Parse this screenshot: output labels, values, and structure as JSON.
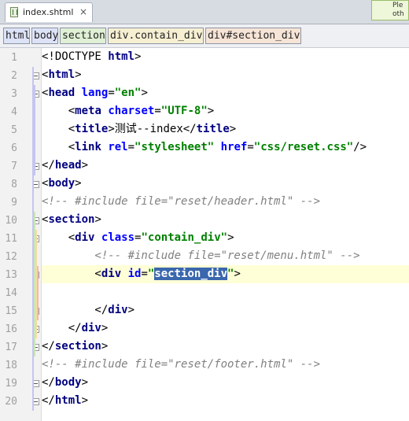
{
  "tab": {
    "filename": "index.shtml",
    "close": "×"
  },
  "hint": {
    "line1": "Ple",
    "line2": "oth"
  },
  "breadcrumb": [
    "html",
    "body",
    "section",
    "div.contain_div",
    "div#section_div"
  ],
  "line_numbers": [
    "1",
    "2",
    "3",
    "4",
    "5",
    "6",
    "7",
    "8",
    "9",
    "10",
    "11",
    "12",
    "13",
    "14",
    "15",
    "16",
    "17",
    "18",
    "19",
    "20"
  ],
  "current_line": "13",
  "code_lines": [
    [
      [
        "p",
        "<!DOCTYPE "
      ],
      [
        "t",
        "html"
      ],
      [
        "p",
        ">"
      ]
    ],
    [
      [
        "p",
        "<"
      ],
      [
        "t",
        "html"
      ],
      [
        "p",
        ">"
      ]
    ],
    [
      [
        "p",
        "<"
      ],
      [
        "t",
        "head"
      ],
      [
        "p",
        " "
      ],
      [
        "a",
        "lang"
      ],
      [
        "p",
        "="
      ],
      [
        "v",
        "\"en\""
      ],
      [
        "p",
        ">"
      ]
    ],
    [
      [
        "p",
        "    <"
      ],
      [
        "t",
        "meta"
      ],
      [
        "p",
        " "
      ],
      [
        "a",
        "charset"
      ],
      [
        "p",
        "="
      ],
      [
        "v",
        "\"UTF-8\""
      ],
      [
        "p",
        ">"
      ]
    ],
    [
      [
        "p",
        "    <"
      ],
      [
        "t",
        "title"
      ],
      [
        "p",
        ">测试--index</"
      ],
      [
        "t",
        "title"
      ],
      [
        "p",
        ">"
      ]
    ],
    [
      [
        "p",
        "    <"
      ],
      [
        "t",
        "link"
      ],
      [
        "p",
        " "
      ],
      [
        "a",
        "rel"
      ],
      [
        "p",
        "="
      ],
      [
        "v",
        "\"stylesheet\""
      ],
      [
        "p",
        " "
      ],
      [
        "a",
        "href"
      ],
      [
        "p",
        "="
      ],
      [
        "v",
        "\"css/reset.css\""
      ],
      [
        "p",
        "/>"
      ]
    ],
    [
      [
        "p",
        "</"
      ],
      [
        "t",
        "head"
      ],
      [
        "p",
        ">"
      ]
    ],
    [
      [
        "p",
        "<"
      ],
      [
        "t",
        "body"
      ],
      [
        "p",
        ">"
      ]
    ],
    [
      [
        "c",
        "<!-- #include file=\"reset/header.html\" -->"
      ]
    ],
    [
      [
        "p",
        "<"
      ],
      [
        "t",
        "section"
      ],
      [
        "p",
        ">"
      ]
    ],
    [
      [
        "p",
        "    <"
      ],
      [
        "t",
        "div"
      ],
      [
        "p",
        " "
      ],
      [
        "a",
        "class"
      ],
      [
        "p",
        "="
      ],
      [
        "v",
        "\"contain_div\""
      ],
      [
        "p",
        ">"
      ]
    ],
    [
      [
        "c",
        "        <!-- #include file=\"reset/menu.html\" -->"
      ]
    ],
    [
      [
        "p",
        "        <"
      ],
      [
        "t",
        "div"
      ],
      [
        "p",
        " "
      ],
      [
        "a",
        "id"
      ],
      [
        "p",
        "="
      ],
      [
        "v",
        "\""
      ],
      [
        "sel",
        "section_div"
      ],
      [
        "v",
        "\""
      ],
      [
        "p",
        ">"
      ]
    ],
    [],
    [
      [
        "p",
        "        </"
      ],
      [
        "t",
        "div"
      ],
      [
        "p",
        ">"
      ]
    ],
    [
      [
        "p",
        "    </"
      ],
      [
        "t",
        "div"
      ],
      [
        "p",
        ">"
      ]
    ],
    [
      [
        "p",
        "</"
      ],
      [
        "t",
        "section"
      ],
      [
        "p",
        ">"
      ]
    ],
    [
      [
        "c",
        "<!-- #include file=\"reset/footer.html\" -->"
      ]
    ],
    [
      [
        "p",
        "</"
      ],
      [
        "t",
        "body"
      ],
      [
        "p",
        ">"
      ]
    ],
    [
      [
        "p",
        "</"
      ],
      [
        "t",
        "html"
      ],
      [
        "p",
        ">"
      ]
    ]
  ],
  "colors": {
    "tag": "#000080",
    "attribute": "#0000ff",
    "string": "#008000",
    "comment": "#808080",
    "selection": "#3a67ad",
    "current_line": "#ffffd7"
  },
  "icons": {
    "file": "file-icon",
    "close": "close-icon",
    "bulb": "lightbulb-icon",
    "fold": "fold-marker-icon"
  }
}
